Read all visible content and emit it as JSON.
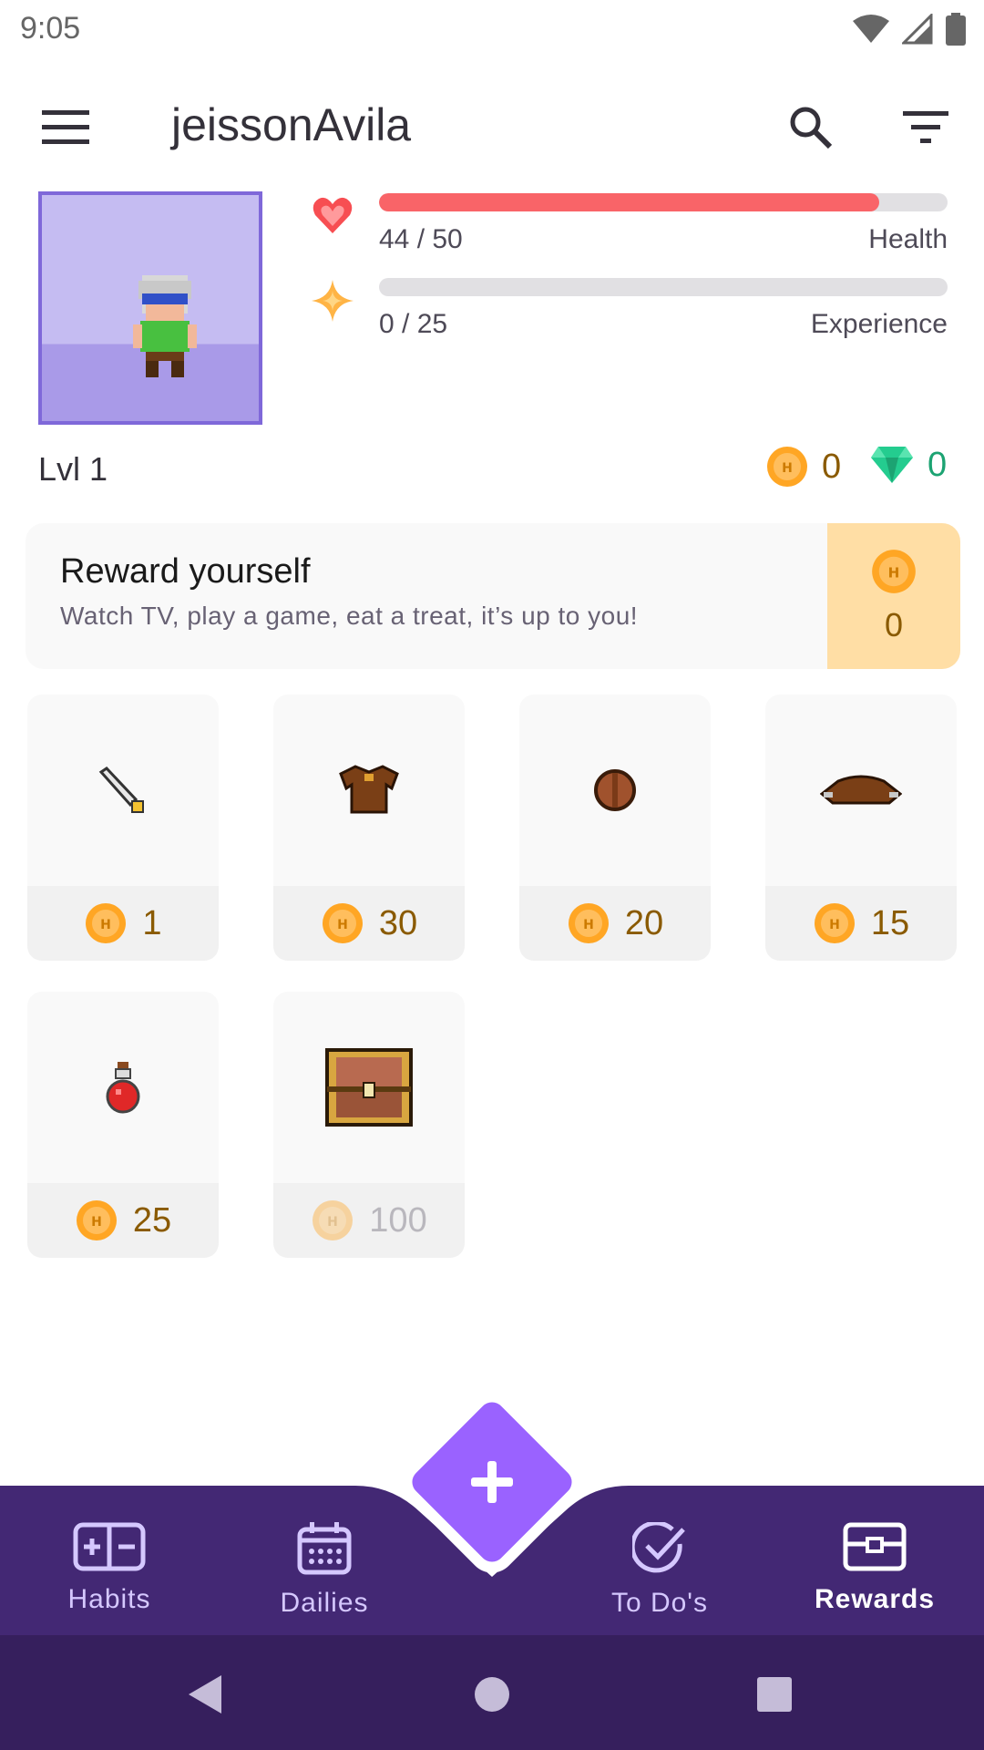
{
  "status_bar": {
    "time": "9:05"
  },
  "app_bar": {
    "title": "jeissonAvila"
  },
  "stats": {
    "health": {
      "value_text": "44 / 50",
      "label": "Health",
      "fraction": 0.88,
      "color": "#f96468"
    },
    "experience": {
      "value_text": "0 / 25",
      "label": "Experience",
      "fraction": 0.0,
      "color": "#ffbe5d"
    }
  },
  "level": "Lvl 1",
  "currency": {
    "gold": "0",
    "gems": "0",
    "gold_color": "#8a5a00",
    "gem_color": "#1ca372"
  },
  "reward_card": {
    "title": "Reward yourself",
    "subtitle": "Watch TV, play a game, eat a treat, it’s up to you!",
    "cost": "0"
  },
  "shop_items": [
    {
      "icon": "sword-icon",
      "price": "1",
      "locked": false
    },
    {
      "icon": "leather-armor-icon",
      "price": "30",
      "locked": false
    },
    {
      "icon": "wooden-shield-icon",
      "price": "20",
      "locked": false
    },
    {
      "icon": "leather-helm-icon",
      "price": "15",
      "locked": false
    },
    {
      "icon": "health-potion-icon",
      "price": "25",
      "locked": false
    },
    {
      "icon": "armoire-chest-icon",
      "price": "100",
      "locked": true
    }
  ],
  "bottom_nav": {
    "habits": "Habits",
    "dailies": "Dailies",
    "todos": "To Do's",
    "rewards": "Rewards",
    "active": "rewards",
    "background": "#432874"
  }
}
